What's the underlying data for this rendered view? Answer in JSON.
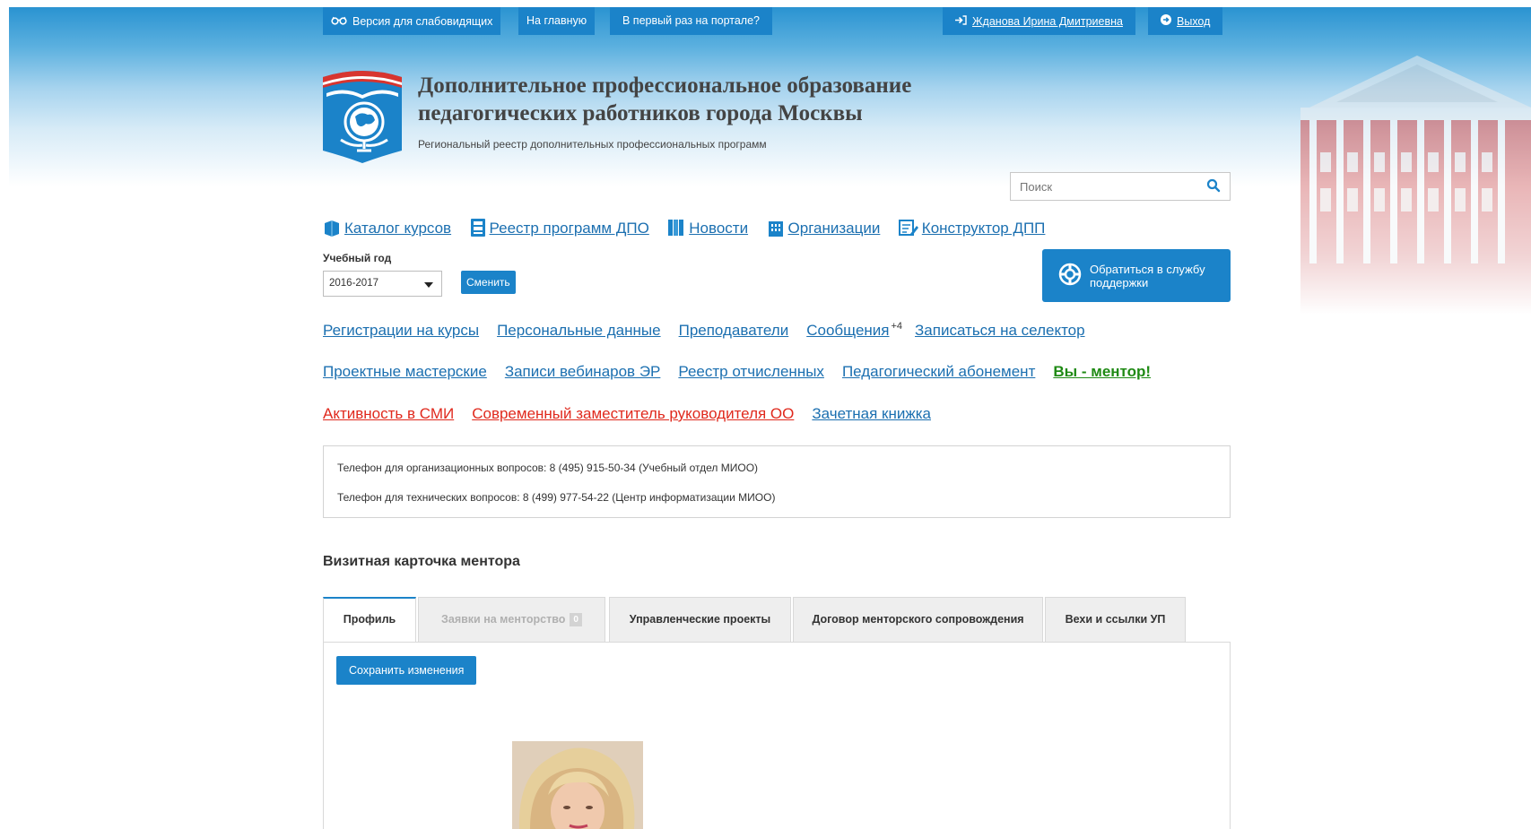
{
  "header": {
    "low_vision_label": "Версия для слабовидящих",
    "home_label": "На главную",
    "first_time_label": "В первый раз на портале?",
    "user_name": "Жданова Ирина Дмитриевна",
    "logout_label": "Выход"
  },
  "site": {
    "title_line1": "Дополнительное профессиональное образование",
    "title_line2": "педагогических работников города Москвы",
    "subtitle": "Региональный реестр дополнительных профессиональных программ"
  },
  "search": {
    "placeholder": "Поиск"
  },
  "main_nav": {
    "catalog": "Каталог курсов",
    "registry": "Реестр программ ДПО",
    "news": "Новости",
    "organizations": "Организации",
    "constructor": "Конструктор ДПП"
  },
  "year": {
    "label": "Учебный год",
    "selected": "2016-2017",
    "change_label": "Сменить"
  },
  "support": {
    "label": "Обратиться в службу поддержки"
  },
  "links": {
    "row1": {
      "registrations": "Регистрации на курсы",
      "personal": "Персональные данные",
      "teachers": "Преподаватели",
      "messages": "Сообщения",
      "messages_badge": "+4",
      "selector": "Записаться на селектор"
    },
    "row2": {
      "workshops": "Проектные мастерские",
      "webinars": "Записи вебинаров ЭР",
      "expelled": "Реестр отчисленных",
      "subscription": "Педагогический абонемент",
      "mentor": "Вы - ментор!"
    },
    "row3": {
      "media": "Активность в СМИ",
      "deputy": "Современный заместитель руководителя ОО",
      "gradebook": "Зачетная книжка"
    }
  },
  "phones": {
    "org": "Телефон для организационных вопросов: 8 (495) 915-50-34 (Учебный отдел МИОО)",
    "tech": "Телефон для технических вопросов: 8 (499) 977-54-22 (Центр информатизации МИОО)"
  },
  "mentor_card": {
    "title": "Визитная карточка ментора",
    "tabs": {
      "profile": "Профиль",
      "requests": "Заявки на менторство",
      "requests_count": "0",
      "projects": "Управленческие проекты",
      "contract": "Договор менторского сопровождения",
      "milestones": "Вехи и ссылки УП"
    },
    "save_label": "Сохранить изменения"
  },
  "colors": {
    "accent": "#1b83c9",
    "link": "#1b6fb0",
    "mentor_green": "#1f8a14",
    "alert_red": "#e0291d"
  }
}
